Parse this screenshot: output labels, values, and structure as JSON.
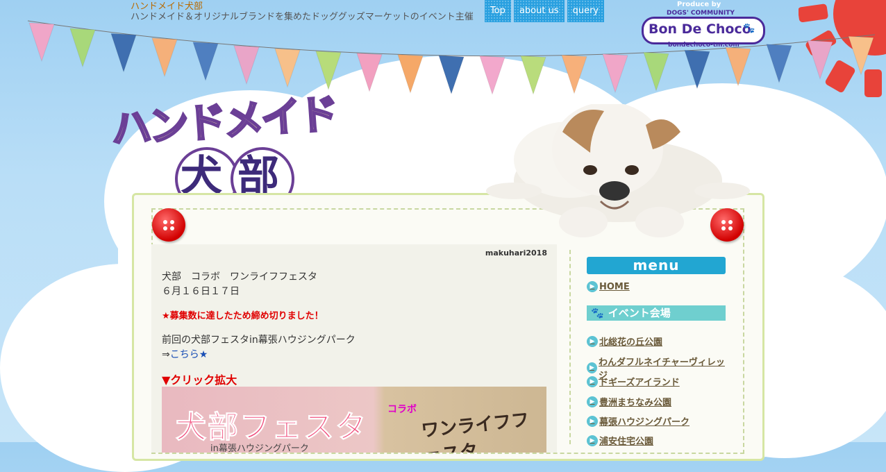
{
  "header": {
    "site_title": "ハンドメイド犬部",
    "site_description": "ハンドメイド＆オリジナルブランドを集めたドッググッズマーケットのイベント主催"
  },
  "topnav": [
    {
      "label": "Top"
    },
    {
      "label": "about us"
    },
    {
      "label": "query"
    }
  ],
  "brand": {
    "produce_by": "Produce by",
    "community": "DOGS' COMMUNITY",
    "name": "Bon De Choco",
    "url": "bondechoco-tm.com"
  },
  "logo": {
    "line1": "ハンドメイド",
    "line2": "犬部"
  },
  "article": {
    "tag": "makuhari2018",
    "title": "犬部　コラボ　ワンライフフェスタ",
    "dates": "６月１６日１７日",
    "closed_notice": "★募集数に達したため締め切りました！",
    "previous_text": "前回の犬部フェスタin幕張ハウジングパーク",
    "previous_arrow": "⇒",
    "previous_link": "こちら★",
    "click_enlarge": "▼クリック拡大",
    "banner_left": "犬部フェスタ",
    "banner_collab": "コラボ",
    "banner_right": "ワンライフフェスタ",
    "banner_sub": "in幕張ハウジングパーク"
  },
  "sidebar": {
    "menu_title": "menu",
    "home": "HOME",
    "event_heading": "イベント会場",
    "venues": [
      "北総花の丘公園",
      "わんダフルネイチャーヴィレッジ",
      "ドギーズアイランド",
      "豊洲まちなみ公園",
      "幕張ハウジングパーク",
      "浦安住宅公園"
    ]
  },
  "colors": {
    "sky": "#b9def7",
    "nav_blue": "#29a0e0",
    "menu_blue": "#22a6d2",
    "notice_red": "#e00000",
    "brand_purple": "#4a2a9a"
  }
}
